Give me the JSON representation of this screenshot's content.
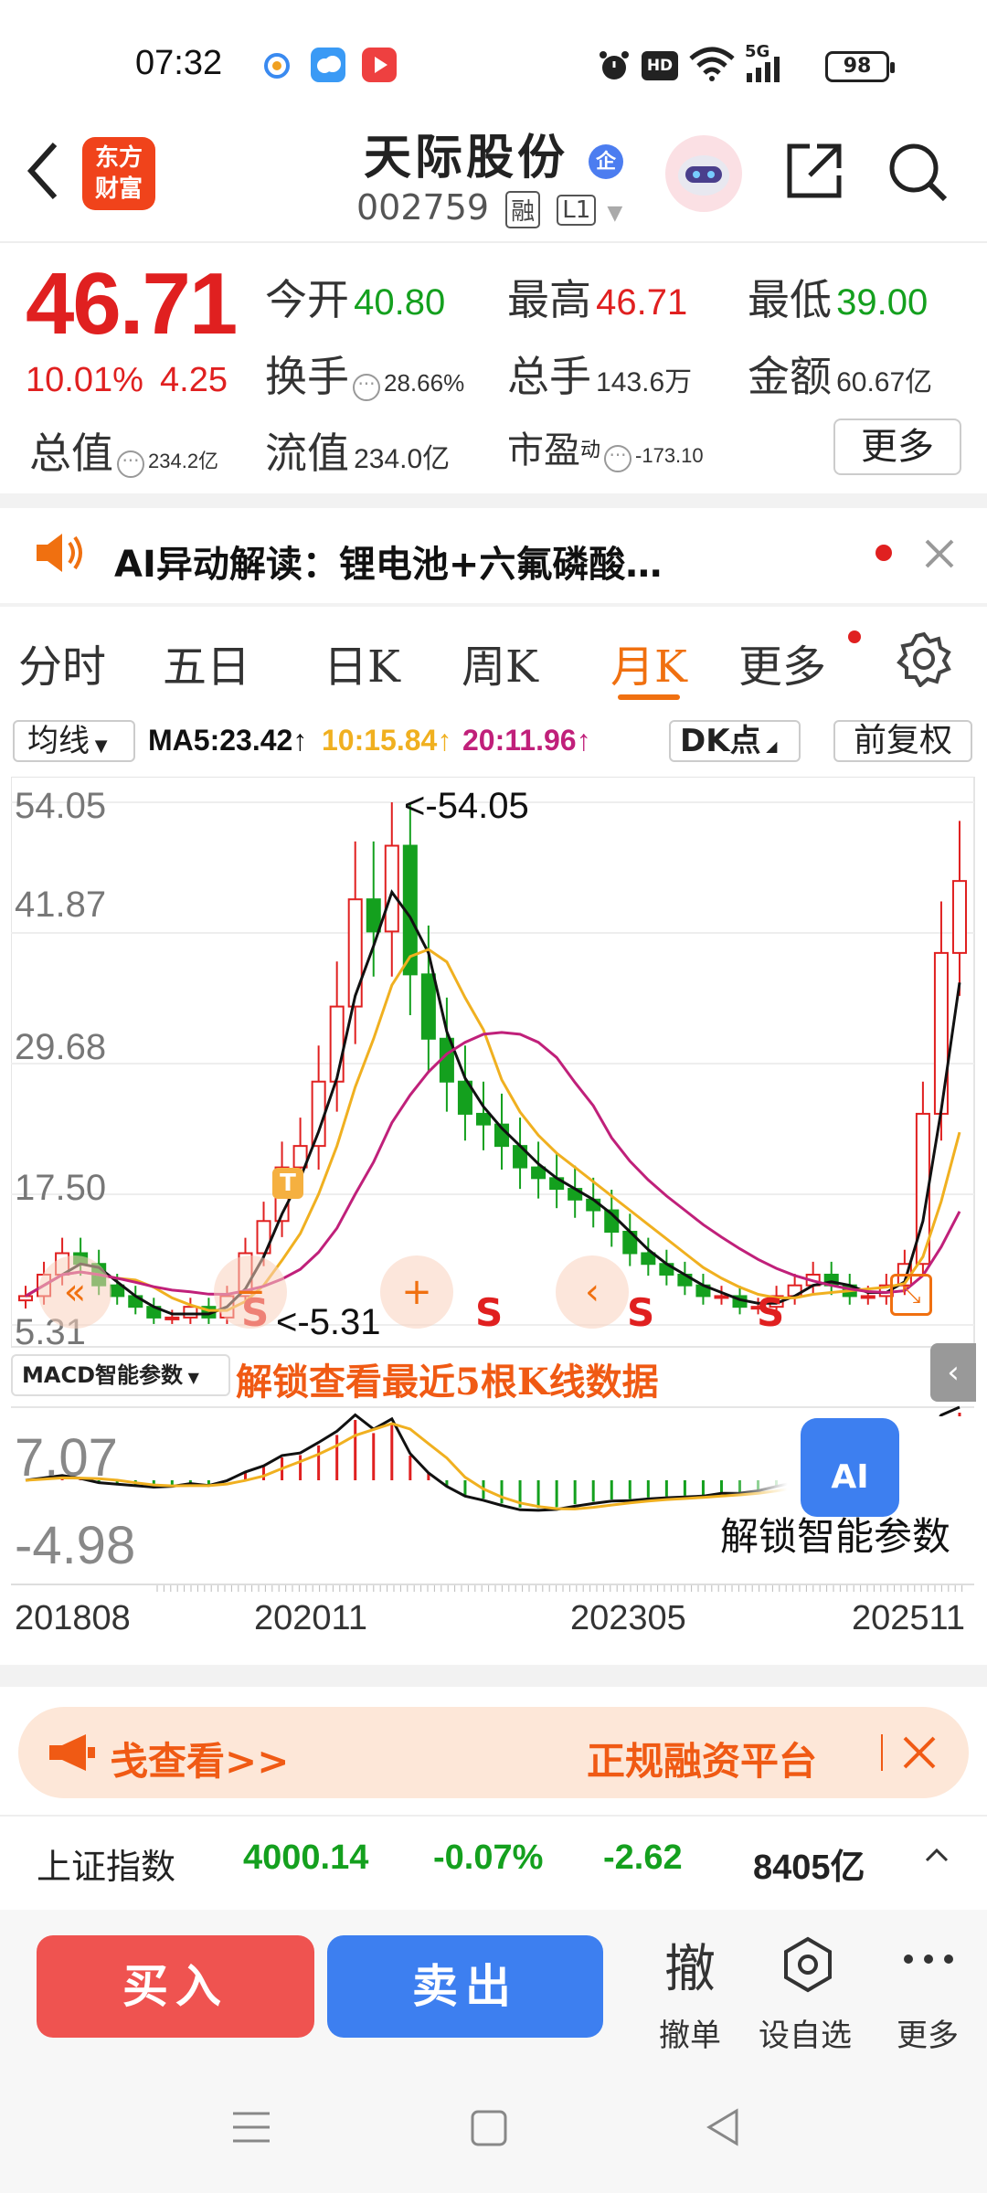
{
  "status_bar": {
    "time": "07:32",
    "battery": "98",
    "network": "5G",
    "hd": "HD",
    "icons": [
      "alarm-icon",
      "hd-icon",
      "wifi-icon",
      "signal-icon",
      "battery-icon"
    ]
  },
  "header": {
    "brand_logo_line1": "东方",
    "brand_logo_line2": "财富",
    "stock_name": "天际股份",
    "badge": "企",
    "stock_code": "002759",
    "tag_margin": "融",
    "tag_level": "L1"
  },
  "quote": {
    "price": "46.71",
    "change_pct": "10.01%",
    "change_amt": "4.25",
    "open_label": "今开",
    "open_value": "40.80",
    "high_label": "最高",
    "high_value": "46.71",
    "low_label": "最低",
    "low_value": "39.00",
    "turnover_label": "换手",
    "turnover_value": "28.66%",
    "volume_label": "总手",
    "volume_value": "143.6万",
    "amount_label": "金额",
    "amount_value": "60.67亿",
    "mktcap_label": "总值",
    "mktcap_value": "234.2亿",
    "float_label": "流值",
    "float_value": "234.0亿",
    "pe_label": "市盈",
    "pe_sup": "动",
    "pe_value": "-173.10",
    "more_label": "更多"
  },
  "ai_banner": {
    "text": "AI异动解读：锂电池+六氟磷酸…"
  },
  "tabs": {
    "items": [
      "分时",
      "五日",
      "日K",
      "周K",
      "月K",
      "更多"
    ],
    "active_index": 4
  },
  "ma_row": {
    "ma_type": "均线",
    "ma5": "MA5:23.42↑",
    "ma10": "10:15.84↑",
    "ma20": "20:11.96↑",
    "dk_label": "DK点",
    "adjust_label": "前复权"
  },
  "chart_data": {
    "type": "candlestick",
    "period": "monthly",
    "y_ticks": [
      "54.05",
      "41.87",
      "29.68",
      "17.50",
      "5.31"
    ],
    "ylim": [
      5.31,
      54.05
    ],
    "high_marker": "54.05",
    "low_marker": "5.31",
    "t_marker": "T",
    "s_markers": [
      "S",
      "S",
      "S",
      "S"
    ],
    "x_labels": [
      "201808",
      "202011",
      "202305",
      "202511"
    ],
    "ma_colors": {
      "ma5": "#111111",
      "ma10": "#f0b020",
      "ma20": "#c0207a"
    },
    "candles_close_approx": [
      8,
      10,
      12,
      11,
      9,
      8,
      7,
      6,
      6,
      7,
      6,
      8,
      12,
      15,
      20,
      22,
      28,
      35,
      45,
      42,
      50,
      38,
      32,
      28,
      25,
      24,
      22,
      20,
      19,
      18,
      17,
      16,
      14,
      12,
      11,
      10,
      9,
      8,
      8,
      7,
      7,
      8,
      9,
      10,
      9,
      8,
      8,
      9,
      11,
      25,
      40,
      46.71
    ],
    "macd": {
      "label": "MACD智能参数",
      "top_value": "7.07",
      "bottom_value": "-4.98",
      "unlock_text": "解锁查看最近5根K线数据",
      "unlock_smart": "解锁智能参数",
      "ai_badge": "AI"
    }
  },
  "promo": {
    "left_text": "戋查看>>",
    "right_text": "正规融资平台"
  },
  "index_bar": {
    "name": "上证指数",
    "value": "4000.14",
    "change_pct": "-0.07%",
    "change_amt": "-2.62",
    "volume": "8405亿"
  },
  "actions": {
    "buy": "买入",
    "sell": "卖出",
    "cancel_glyph": "撤",
    "cancel_label": "撤单",
    "watch_label": "设自选",
    "more_label": "更多"
  }
}
